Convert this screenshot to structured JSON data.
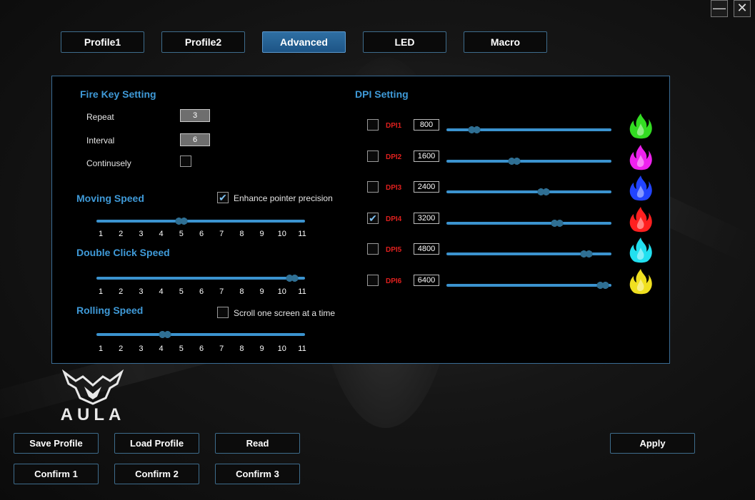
{
  "window": {
    "minimize_glyph": "—",
    "close_glyph": "✕"
  },
  "tabs": [
    {
      "label": "Profile1"
    },
    {
      "label": "Profile2"
    },
    {
      "label": "Advanced"
    },
    {
      "label": "LED"
    },
    {
      "label": "Macro"
    }
  ],
  "fire_key": {
    "title": "Fire Key Setting",
    "repeat_label": "Repeat",
    "repeat_value": "3",
    "interval_label": "Interval",
    "interval_value": "6",
    "continuously_label": "Continusely"
  },
  "moving_speed": {
    "title": "Moving Speed",
    "enhance_label": "Enhance pointer precision",
    "value": 5
  },
  "double_click": {
    "title": "Double Click Speed",
    "value": 10.5
  },
  "rolling_speed": {
    "title": "Rolling Speed",
    "scroll_label": "Scroll one screen at a time",
    "value": 4.2
  },
  "ticks": [
    "1",
    "2",
    "3",
    "4",
    "5",
    "6",
    "7",
    "8",
    "9",
    "10",
    "11"
  ],
  "dpi": {
    "title": "DPI Setting",
    "levels": [
      {
        "label": "DPI1",
        "value": "800",
        "checked": false,
        "slider": 0.17,
        "color": "#33dd22"
      },
      {
        "label": "DPI2",
        "value": "1600",
        "checked": false,
        "slider": 0.41,
        "color": "#ee22ee"
      },
      {
        "label": "DPI3",
        "value": "2400",
        "checked": false,
        "slider": 0.59,
        "color": "#2244ff"
      },
      {
        "label": "DPI4",
        "value": "3200",
        "checked": true,
        "slider": 0.67,
        "color": "#ff2020"
      },
      {
        "label": "DPI5",
        "value": "4800",
        "checked": false,
        "slider": 0.85,
        "color": "#22e0f0"
      },
      {
        "label": "DPI6",
        "value": "6400",
        "checked": false,
        "slider": 0.95,
        "color": "#f0e020"
      }
    ]
  },
  "logo": {
    "text": "AULA"
  },
  "buttons": {
    "save_profile": "Save Profile",
    "load_profile": "Load Profile",
    "read": "Read",
    "apply": "Apply",
    "confirm1": "Confirm 1",
    "confirm2": "Confirm 2",
    "confirm3": "Confirm 3"
  },
  "colors": {
    "accent": "#3f9ad8",
    "dpi_label": "#e0201e",
    "track": "#3b93cf"
  }
}
